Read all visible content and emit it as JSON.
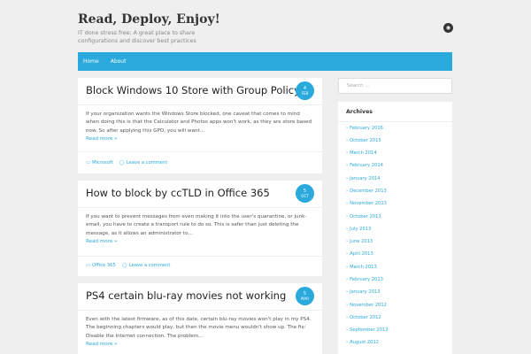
{
  "site": {
    "title": "Read, Deploy, Enjoy!",
    "description": "IT done stress free: A great place to share configurations and discover best practices"
  },
  "nav": {
    "items": [
      "Home",
      "About"
    ]
  },
  "posts": [
    {
      "title": "Block Windows 10 Store with Group Policy",
      "day": "4",
      "month": "FEB",
      "excerpt": "If your organization wants the Windows Store blocked, one caveat that comes to mind when doing this is that the Calculator and Photos apps won't work, as they are store based now.  So after applying this GPO, you will want…",
      "read_more": "Read more »",
      "category": "Microsoft",
      "comment": "Leave a comment"
    },
    {
      "title": "How to block by ccTLD in Office 365",
      "day": "5",
      "month": "OCT",
      "excerpt": "If you want to prevent messages from even making it into the user's quarantine, or junk-email, you have to create a transport rule to do so. This is safer than just deleting the message, as it allows an administrator to…",
      "read_more": "Read more »",
      "category": "Office 365",
      "comment": "Leave a comment"
    },
    {
      "title": "PS4 certain blu-ray movies not working",
      "day": "5",
      "month": "MAR",
      "excerpt": "Even with the latest firmware, as of this date, certain blu-ray movies won't play in my PS4. The beginning chapters would play, but then the movie menu wouldn't show up.  The fix: Disable the Internet connection.   The problem…",
      "read_more": "Read more »"
    }
  ],
  "sidebar": {
    "search_placeholder": "Search ...",
    "archives_title": "Archives",
    "archives": [
      "February 2016",
      "October 2015",
      "March 2014",
      "February 2014",
      "January 2014",
      "December 2013",
      "November 2013",
      "October 2013",
      "July 2013",
      "June 2013",
      "April 2013",
      "March 2013",
      "February 2013",
      "January 2013",
      "November 2012",
      "October 2012",
      "September 2012",
      "August 2012"
    ]
  },
  "colors": {
    "accent": "#29a9dc",
    "background": "#efefef"
  },
  "icons": {
    "rss": "rss-icon",
    "category": "folder-icon",
    "comment": "comment-icon",
    "chevron": "chevron-right-icon"
  }
}
